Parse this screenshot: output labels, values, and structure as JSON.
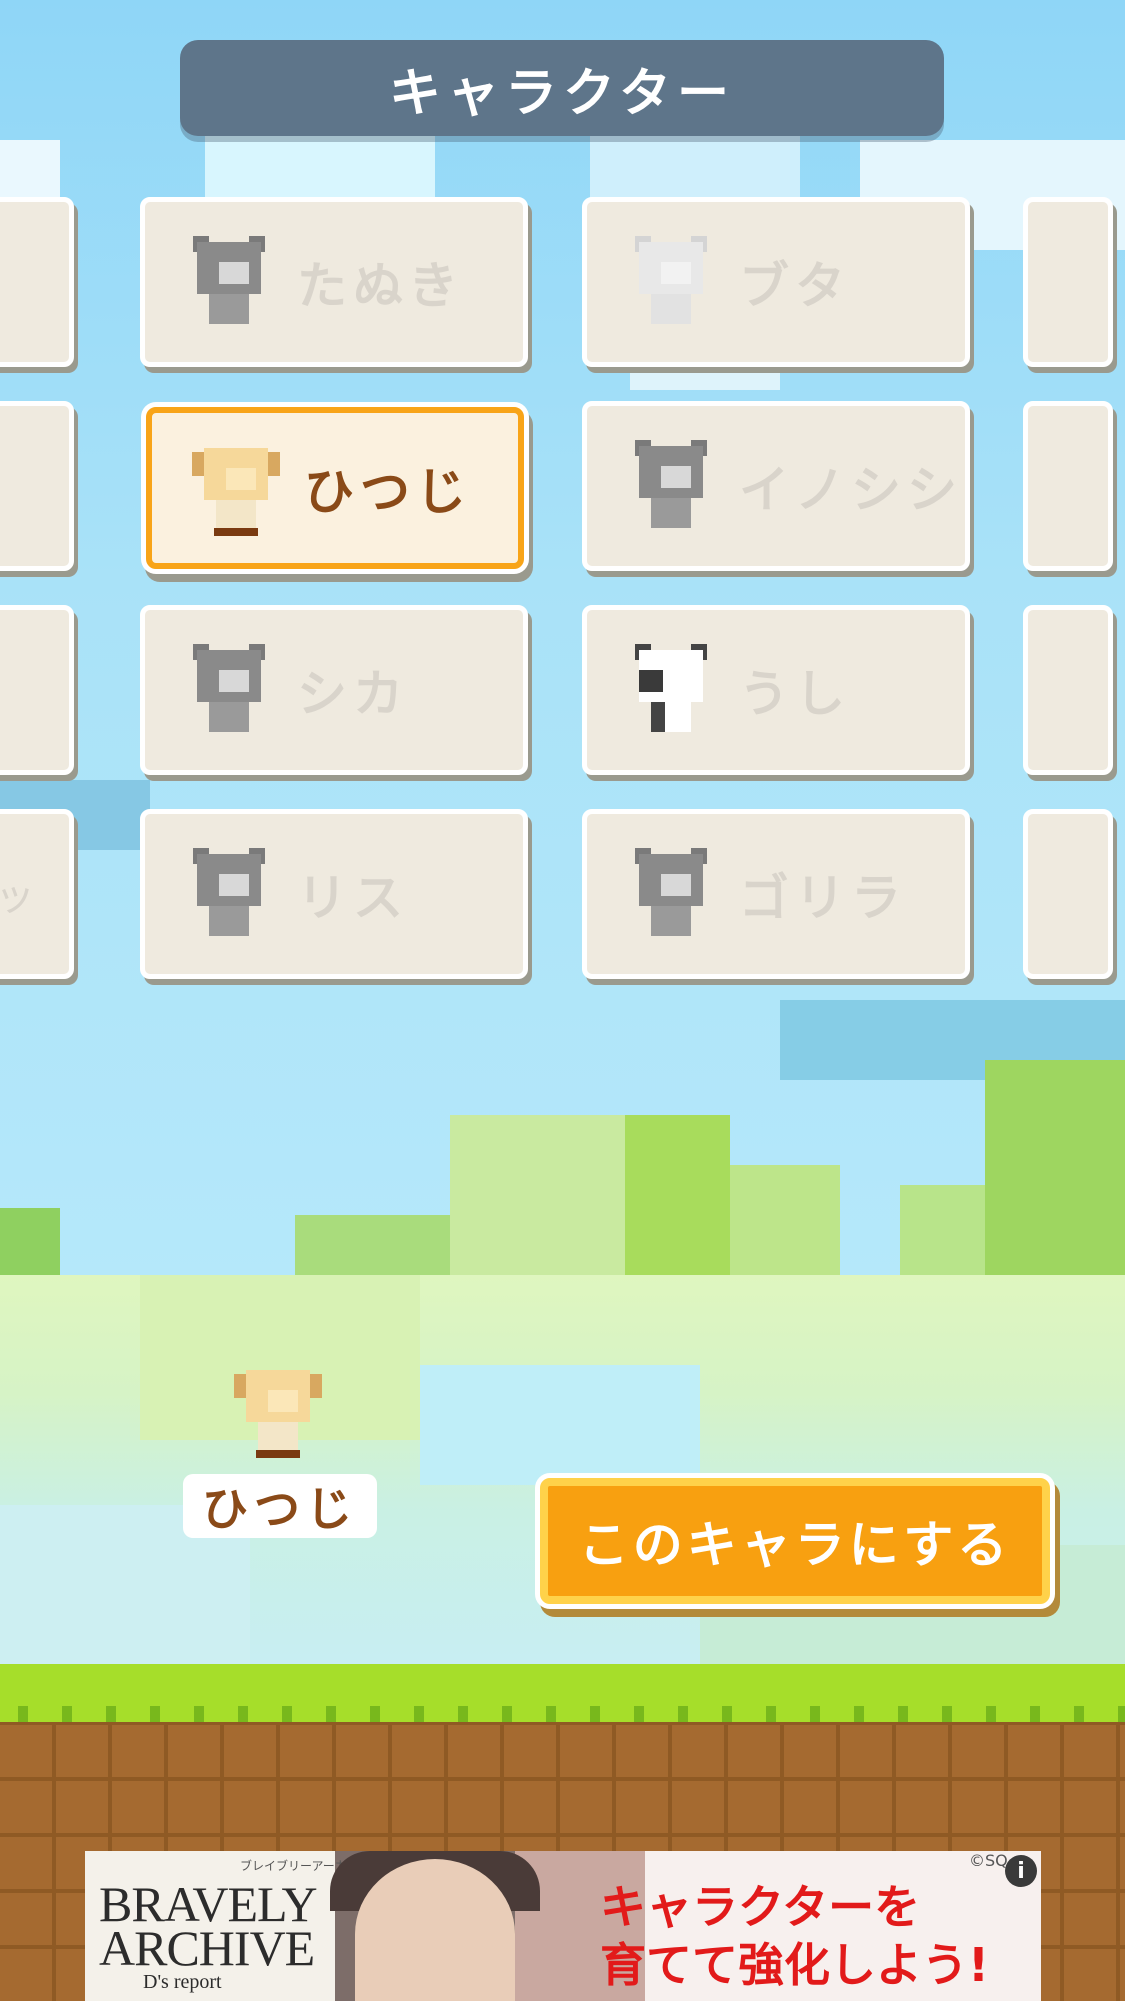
{
  "header": {
    "title": "キャラクター"
  },
  "grid": {
    "left_edge_label": "ッ",
    "tiles": [
      {
        "label": "たぬき",
        "animal": "tanuki-icon",
        "selected": false
      },
      {
        "label": "ブタ",
        "animal": "pig-icon",
        "selected": false
      },
      {
        "label": "ひつじ",
        "animal": "sheep-icon",
        "selected": true
      },
      {
        "label": "イノシシ",
        "animal": "boar-icon",
        "selected": false
      },
      {
        "label": "シカ",
        "animal": "deer-icon",
        "selected": false
      },
      {
        "label": "うし",
        "animal": "cow-icon",
        "selected": false
      },
      {
        "label": "リス",
        "animal": "squirrel-icon",
        "selected": false
      },
      {
        "label": "ゴリラ",
        "animal": "gorilla-icon",
        "selected": false
      }
    ]
  },
  "preview": {
    "name": "ひつじ",
    "animal": "sheep-icon"
  },
  "actions": {
    "select_label": "このキャラにする",
    "accent": "#f8a010"
  },
  "ad": {
    "logo_small": "ブレイブリーアーカイブ",
    "logo_line1": "BRAVELY",
    "logo_line2": "ARCHIVE",
    "logo_sub": "D's report",
    "headline_1": "キャラクターを",
    "headline_2": "育てて強化しよう!",
    "copyright": "©SQ",
    "info_icon": "info-icon"
  },
  "colors": {
    "title_bar": "#5e758a",
    "selected_border": "#f8a418",
    "grass": "#a6de2a",
    "dirt": "#a56a30"
  }
}
